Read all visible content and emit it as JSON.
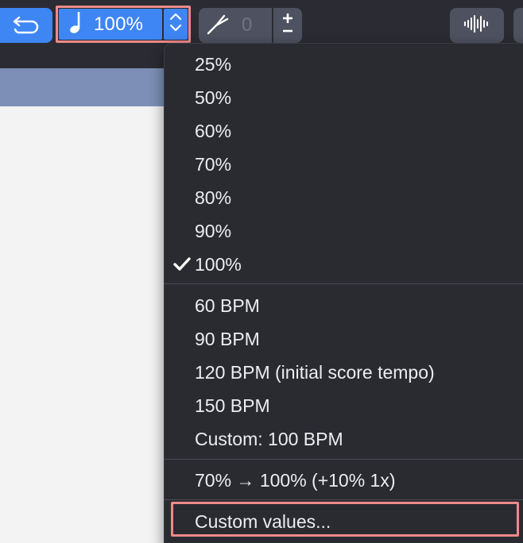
{
  "toolbar": {
    "tempo_label": "100%",
    "tuning_value": "0",
    "icons": {
      "loop": "loop-back-icon",
      "note": "quarter-note-icon",
      "stepper": "up-down-chevron-icon",
      "tuning": "tuning-fork-icon",
      "plusminus": "plus-minus-icon",
      "waveform": "waveform-icon"
    }
  },
  "menu": {
    "percent_items": [
      "25%",
      "50%",
      "60%",
      "70%",
      "80%",
      "90%",
      "100%"
    ],
    "selected": "100%",
    "bpm_items": [
      "60 BPM",
      "90 BPM",
      "120 BPM (initial score tempo)",
      "150 BPM",
      "Custom: 100 BPM"
    ],
    "progression_item": "70% → 100% (+10% 1x)",
    "custom_values_item": "Custom values..."
  },
  "colors": {
    "accent": "#3e86f4",
    "highlight_outline": "#ee8a8a",
    "menu_bg": "#2a2b31",
    "toolbar_bg": "#2b2c33",
    "band": "#7d8fb6"
  }
}
